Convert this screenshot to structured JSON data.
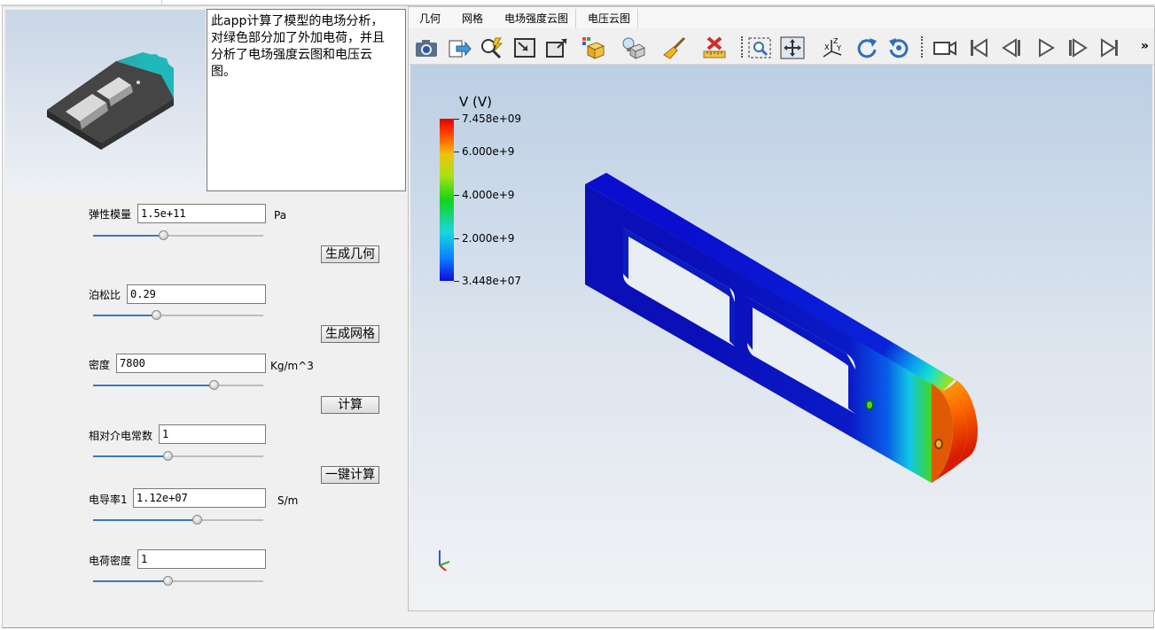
{
  "description": "此app计算了模型的电场分析，\n对绿色部分加了外加电荷，并且\n分析了电场强度云图和电压云\n图。",
  "params": [
    {
      "label": "弹性模量",
      "value": "1.5e+11",
      "unit": "Pa",
      "slider": 0.41
    },
    {
      "label": "泊松比",
      "value": "0.29",
      "unit": "",
      "slider": 0.37
    },
    {
      "label": "密度",
      "value": "7800",
      "unit": "Kg/m^3",
      "slider": 0.71
    },
    {
      "label": "相对介电常数",
      "value": "1",
      "unit": "",
      "slider": 0.44
    },
    {
      "label": "电导率1",
      "value": "1.12e+07",
      "unit": "S/m",
      "slider": 0.61
    },
    {
      "label": "电荷密度",
      "value": "1",
      "unit": "",
      "slider": 0.44
    }
  ],
  "buttons": {
    "gen_geometry": "生成几何",
    "gen_mesh": "生成网格",
    "compute": "计算",
    "one_click": "一键计算"
  },
  "tabs": [
    "几何",
    "网格",
    "电场强度云图",
    "电压云图"
  ],
  "toolbar": {
    "icons": [
      "camera-icon",
      "export-icon",
      "zoom-selection-icon",
      "zoom-box-icon",
      "zoom-extents-icon",
      "view-cube-icon",
      "light-icon",
      "clear-brush-icon",
      "delete-measure-icon",
      "zoom-window-icon",
      "pan-icon",
      "axes-orient-icon",
      "rotate-cw-icon",
      "rotate-ccw-icon",
      "video-camera-icon",
      "first-frame-icon",
      "prev-frame-icon",
      "play-icon",
      "next-frame-icon",
      "last-frame-icon"
    ],
    "overflow": "»"
  },
  "colorbar": {
    "title": "V (V)",
    "max": "7.458e+09",
    "ticks": [
      "6.000e+9",
      "4.000e+9",
      "2.000e+9"
    ],
    "min": "3.448e+07",
    "colors": [
      "#0a0dd9",
      "#0b7fff",
      "#18d8e0",
      "#16d21a",
      "#f2c10e",
      "#ff4a00",
      "#e00000"
    ]
  }
}
